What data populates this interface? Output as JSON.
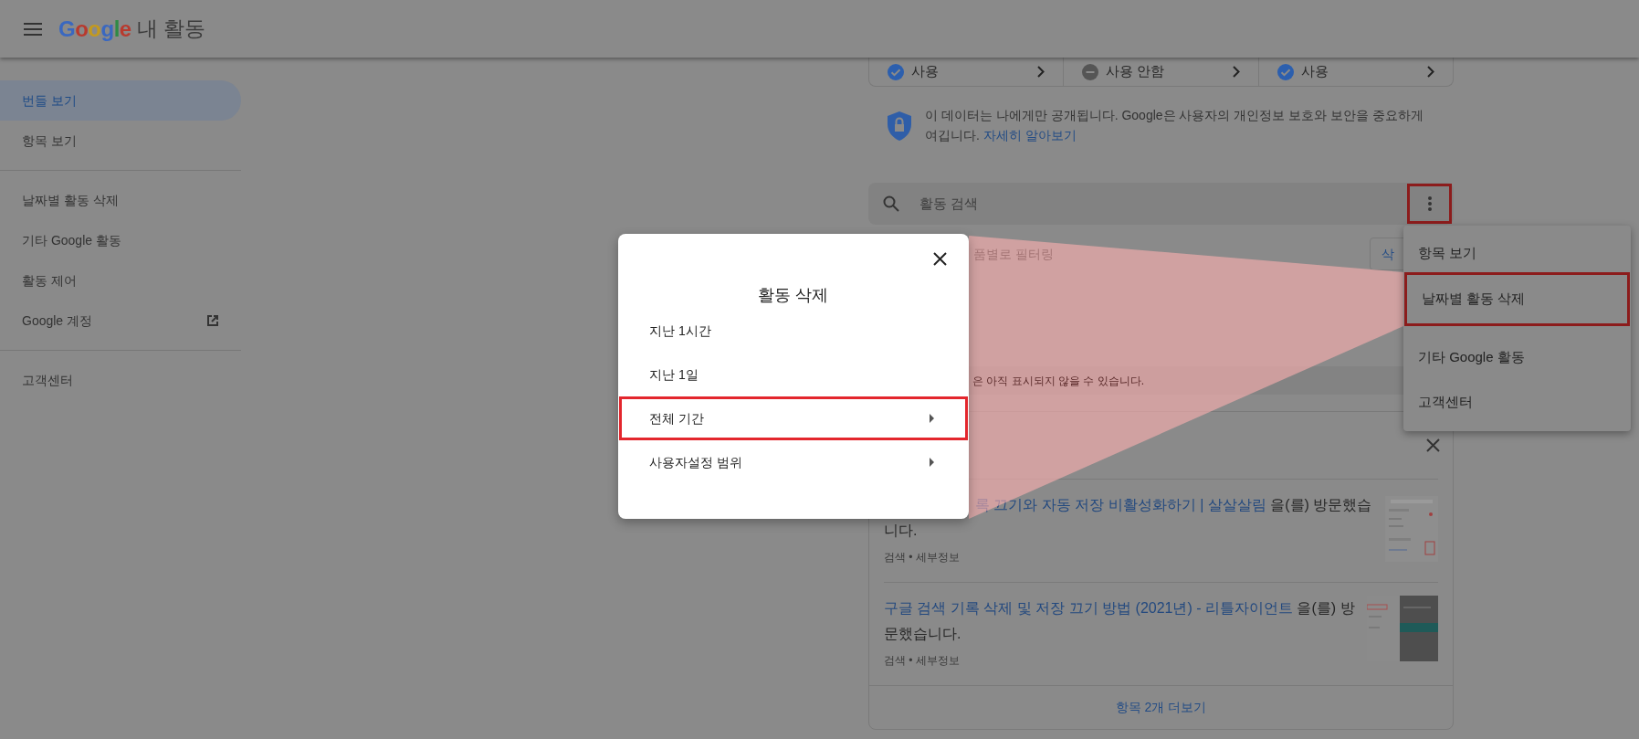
{
  "header": {
    "logo": "Google",
    "title": "내 활동"
  },
  "sidebar": {
    "groups": [
      {
        "items": [
          {
            "label": "번들 보기",
            "selected": true,
            "kind": "page"
          },
          {
            "label": "항목 보기",
            "selected": false,
            "kind": "page"
          }
        ]
      },
      {
        "items": [
          {
            "label": "날짜별 활동 삭제",
            "selected": false,
            "kind": "page"
          },
          {
            "label": "기타 Google 활동",
            "selected": false,
            "kind": "page"
          },
          {
            "label": "활동 제어",
            "selected": false,
            "kind": "page"
          },
          {
            "label": "Google 계정",
            "selected": false,
            "kind": "external"
          }
        ]
      },
      {
        "items": [
          {
            "label": "고객센터",
            "selected": false,
            "kind": "page"
          }
        ]
      }
    ]
  },
  "toggles": [
    {
      "label": "사용",
      "on": true
    },
    {
      "label": "사용 안함",
      "on": false
    },
    {
      "label": "사용",
      "on": true
    }
  ],
  "privacy_notice": {
    "text": "이 데이터는 나에게만 공개됩니다. Google은 사용자의 개인정보 보호와 보안을 중요하게 여깁니다.",
    "link": "자세히 알아보기"
  },
  "search": {
    "placeholder": "활동 검색",
    "more_button_highlighted": true
  },
  "filter": {
    "label": "품별로 필터링",
    "delete_button": "삭"
  },
  "notice": "은 아직 표시되지 않을 수 있습니다.",
  "bundle": {
    "items": [
      {
        "link": "록 끄기와 자동 저장 비활성화하기 | 살살살림",
        "suffix_lines": [
          "을(를) 방문했습",
          "니다."
        ],
        "meta": "검색 • 세부정보"
      },
      {
        "link": "구글 검색 기록 삭제 및 저장 끄기 방법 (2021년) - 리틀자이언트",
        "suffix_lines": [
          "을(를) 방",
          "문했습니다."
        ],
        "meta": "검색 • 세부정보"
      }
    ],
    "more": "항목 2개 더보기"
  },
  "menu": {
    "items": [
      {
        "label": "항목 보기",
        "selected": false
      },
      {
        "label": "날짜별 활동 삭제",
        "selected": true
      },
      {
        "label": "기타 Google 활동",
        "selected": false
      },
      {
        "label": "고객센터",
        "selected": false
      }
    ]
  },
  "dialog": {
    "title": "활동 삭제",
    "options": [
      {
        "label": "지난 1시간",
        "selected": false,
        "submenu": false
      },
      {
        "label": "지난 1일",
        "selected": false,
        "submenu": false
      },
      {
        "label": "전체 기간",
        "selected": true,
        "submenu": true
      },
      {
        "label": "사용자설정 범위",
        "selected": false,
        "submenu": true
      }
    ]
  }
}
